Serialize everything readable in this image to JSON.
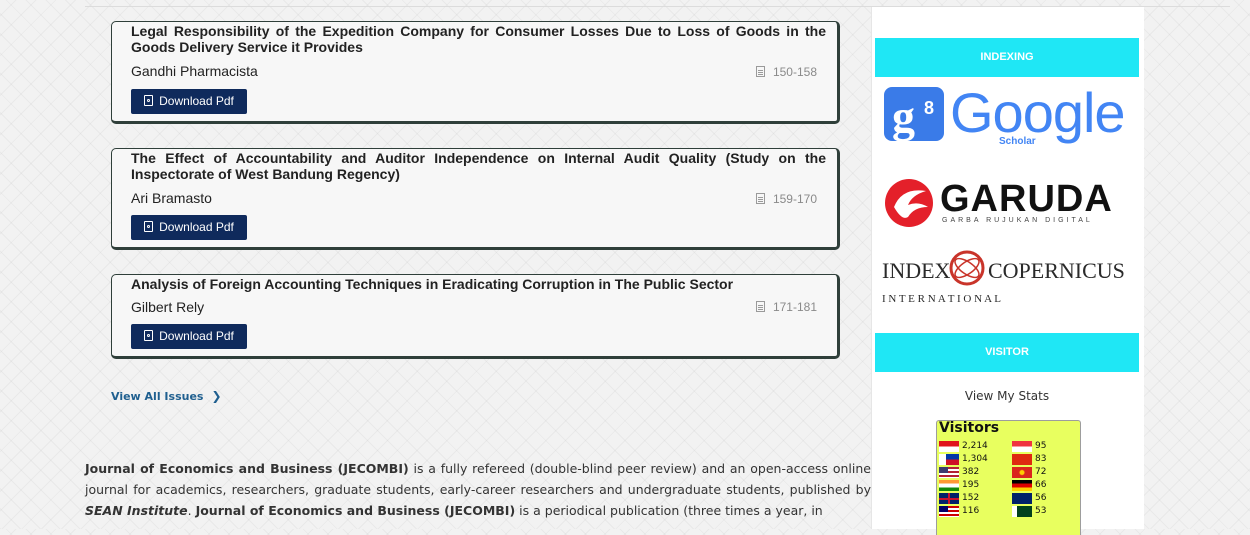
{
  "articles": [
    {
      "title": "Legal Responsibility of the Expedition Company for Consumer Losses Due to Loss of Goods in the Goods Delivery Service it Provides",
      "author": "Gandhi Pharmacista",
      "pages": "150-158",
      "download_label": "Download Pdf"
    },
    {
      "title": "The Effect of Accountability and Auditor Independence on Internal Audit Quality (Study on the Inspectorate of West Bandung Regency)",
      "author": "Ari Bramasto",
      "pages": "159-170",
      "download_label": "Download Pdf"
    },
    {
      "title": "Analysis of Foreign Accounting Techniques in Eradicating Corruption in The Public Sector",
      "author": "Gilbert Rely",
      "pages": "171-181",
      "download_label": "Download Pdf"
    }
  ],
  "view_all": {
    "label": "View All Issues"
  },
  "description": {
    "journal_name": "Journal of Economics and Business (JECOMBI)",
    "text1": " is a fully refereed (double-blind peer review) and an open-access online journal for academics, researchers, graduate students, early-career researchers and undergraduate students, published by ",
    "publisher": "SEAN Institute",
    "text2": ". ",
    "journal_name2": "Journal of Economics and Business (JECOMBI)",
    "text3": " is a periodical publication (three times a year, in"
  },
  "sidebar": {
    "indexing_title": "INDEXING",
    "google": {
      "text": "Google",
      "sub": "Scholar"
    },
    "garuda": {
      "text": "GARUDA",
      "sub": "GARBA RUJUKAN DIGITAL"
    },
    "copernicus": {
      "left": "INDEX",
      "right": "COPERNICUS",
      "sub": "I N T E R N A T I O N A L"
    },
    "visitor_title": "VISITOR",
    "view_stats": "View My Stats",
    "visitors": {
      "title": "Visitors",
      "left": [
        {
          "count": "2,214",
          "flag": "indonesia-flag"
        },
        {
          "count": "1,304",
          "flag": "philippines-flag"
        },
        {
          "count": "382",
          "flag": "usa-flag"
        },
        {
          "count": "195",
          "flag": "india-flag"
        },
        {
          "count": "152",
          "flag": "uk-flag"
        },
        {
          "count": "116",
          "flag": "malaysia-flag"
        }
      ],
      "right": [
        {
          "count": "95",
          "flag": "singapore-flag"
        },
        {
          "count": "83",
          "flag": "china-flag"
        },
        {
          "count": "72",
          "flag": "vietnam-flag"
        },
        {
          "count": "66",
          "flag": "germany-flag"
        },
        {
          "count": "56",
          "flag": "australia-flag"
        },
        {
          "count": "53",
          "flag": "pakistan-flag"
        }
      ]
    }
  },
  "colors": {
    "accent": "#1fe7f5",
    "button": "#0f2a5c",
    "link": "#1f5f8f",
    "visitor_bg": "#e8ff5f"
  }
}
